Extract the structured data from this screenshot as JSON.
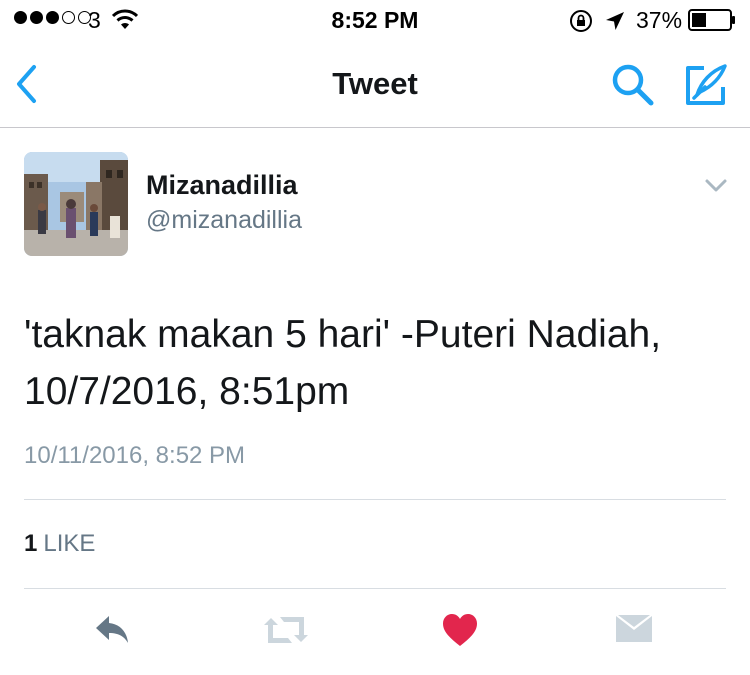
{
  "status_bar": {
    "carrier": "3",
    "time": "8:52 PM",
    "battery": "37%"
  },
  "nav": {
    "title": "Tweet",
    "icons": [
      "back-icon",
      "search-icon",
      "compose-icon"
    ],
    "accent_color": "#1da1f2"
  },
  "tweet": {
    "display_name": "Mizanadillia",
    "handle": "@mizanadillia",
    "text": "'taknak makan 5 hari' -Puteri Nadiah, 10/7/2016, 8:51pm",
    "timestamp": "10/11/2016, 8:52 PM",
    "likes_count": "1",
    "likes_label": "LIKE",
    "liked": true
  },
  "actions": {
    "icons": [
      "reply-icon",
      "retweet-icon",
      "like-icon",
      "direct-message-icon"
    ],
    "like_color": "#e2264d"
  }
}
